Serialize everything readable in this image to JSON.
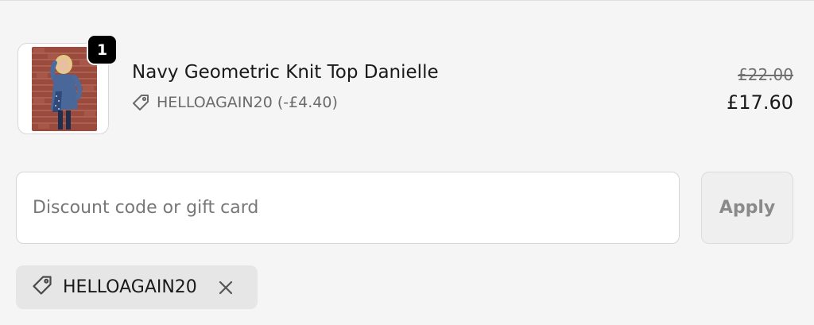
{
  "line_item": {
    "quantity": "1",
    "title": "Navy Geometric Knit Top Danielle",
    "discount_label": "HELLOAGAIN20 (-£4.40)",
    "price_original": "£22.00",
    "price_final": "£17.60",
    "image_alt": "Navy Geometric Knit Top Danielle",
    "tag_icon": "tag-icon"
  },
  "discount_form": {
    "placeholder": "Discount code or gift card",
    "value": "",
    "apply_label": "Apply"
  },
  "applied_code": {
    "code": "HELLOAGAIN20",
    "tag_icon": "tag-icon",
    "remove_icon": "close-icon"
  }
}
